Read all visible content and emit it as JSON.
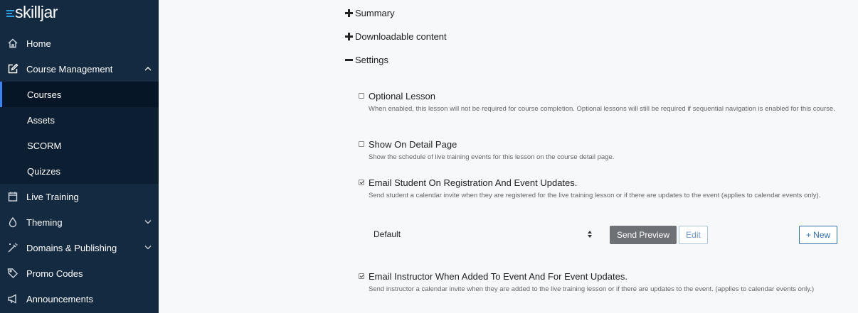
{
  "brand": {
    "name": "skilljar"
  },
  "sidebar": {
    "items": [
      {
        "label": "Home",
        "icon": "home-icon"
      },
      {
        "label": "Course Management",
        "icon": "edit-icon",
        "expanded": true
      },
      {
        "label": "Live Training",
        "icon": "calendar-icon"
      },
      {
        "label": "Theming",
        "icon": "droplet-icon"
      },
      {
        "label": "Domains & Publishing",
        "icon": "magic-wand-icon"
      },
      {
        "label": "Promo Codes",
        "icon": "tag-icon"
      },
      {
        "label": "Announcements",
        "icon": "megaphone-icon"
      }
    ],
    "submenu": [
      {
        "label": "Courses",
        "active": true
      },
      {
        "label": "Assets"
      },
      {
        "label": "SCORM"
      },
      {
        "label": "Quizzes"
      }
    ]
  },
  "sections": {
    "summary": "Summary",
    "downloadable": "Downloadable content",
    "settings": "Settings"
  },
  "settings": {
    "optional_lesson": {
      "title": "Optional Lesson",
      "checked": false,
      "desc": "When enabled, this lesson will not be required for course completion. Optional lessons will still be required if sequential navigation is enabled for this course."
    },
    "show_on_detail": {
      "title": "Show On Detail Page",
      "checked": false,
      "desc": "Show the schedule of live training events for this lesson on the course detail page."
    },
    "email_student": {
      "title": "Email Student On Registration And Event Updates.",
      "checked": true,
      "desc": "Send student a calendar invite when they are registered for the live training lesson or if there are updates to the event (applies to calendar events only)."
    },
    "template_select": {
      "value": "Default"
    },
    "buttons": {
      "send_preview": "Send Preview",
      "edit": "Edit",
      "new": "+ New"
    },
    "email_instructor": {
      "title": "Email Instructor When Added To Event And For Event Updates.",
      "checked": true,
      "desc": "Send instructor a calendar invite when they are added to the live training lesson or if there are updates to the event. (applies to calendar events only.)"
    }
  },
  "colors": {
    "sidebar_bg": "#142a40",
    "submenu_bg": "#0c1e31",
    "active_indicator": "#3b82f6",
    "send_preview_bg": "#6d7075",
    "new_button": "#2f6fb0"
  }
}
